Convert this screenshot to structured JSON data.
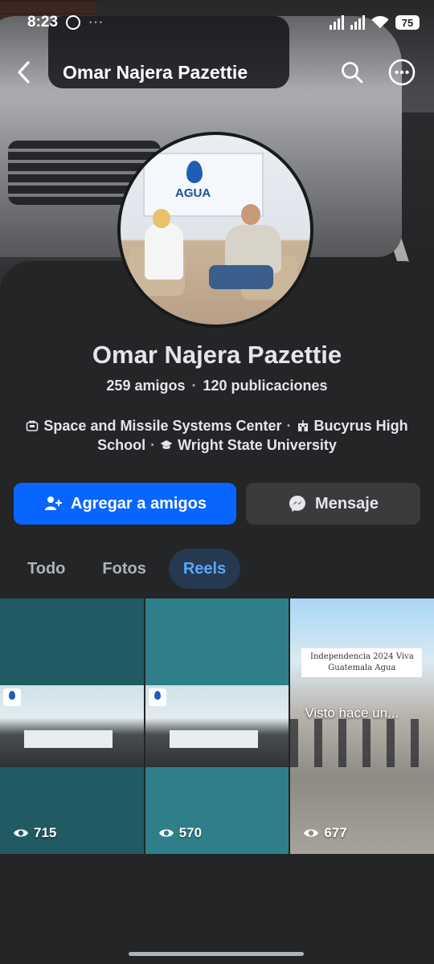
{
  "status_bar": {
    "time": "8:23",
    "more": "···",
    "battery": "75"
  },
  "nav": {
    "title": "Omar Najera Pazettie"
  },
  "avatar": {
    "banner_text": "AGUA"
  },
  "profile": {
    "name": "Omar Najera Pazettie",
    "friends": "259 amigos",
    "separator": "·",
    "posts": "120 publicaciones",
    "work_1": "Space and Missile Systems Center",
    "work_2": "Bucyrus High School",
    "education": "Wright State University"
  },
  "actions": {
    "add_friend": "Agregar a amigos",
    "message": "Mensaje"
  },
  "tabs": [
    {
      "label": "Todo",
      "active": false
    },
    {
      "label": "Fotos",
      "active": false
    },
    {
      "label": "Reels",
      "active": true
    }
  ],
  "reels": [
    {
      "views": "715",
      "logo": "AGUA"
    },
    {
      "views": "570",
      "logo": "AGUA"
    },
    {
      "views": "677",
      "caption": "Independencia 2024 Viva Guatemala Agua",
      "overlay": "Visto hace un..."
    }
  ],
  "colors": {
    "primary": "#0866ff",
    "card": "#242526",
    "tab_active_bg": "#263951",
    "tab_active_text": "#5aa7ff"
  },
  "icons": [
    "back-arrow-icon",
    "search-icon",
    "more-icon",
    "briefcase-icon",
    "school-icon",
    "graduation-cap-icon",
    "add-friend-icon",
    "messenger-icon",
    "eye-icon"
  ]
}
